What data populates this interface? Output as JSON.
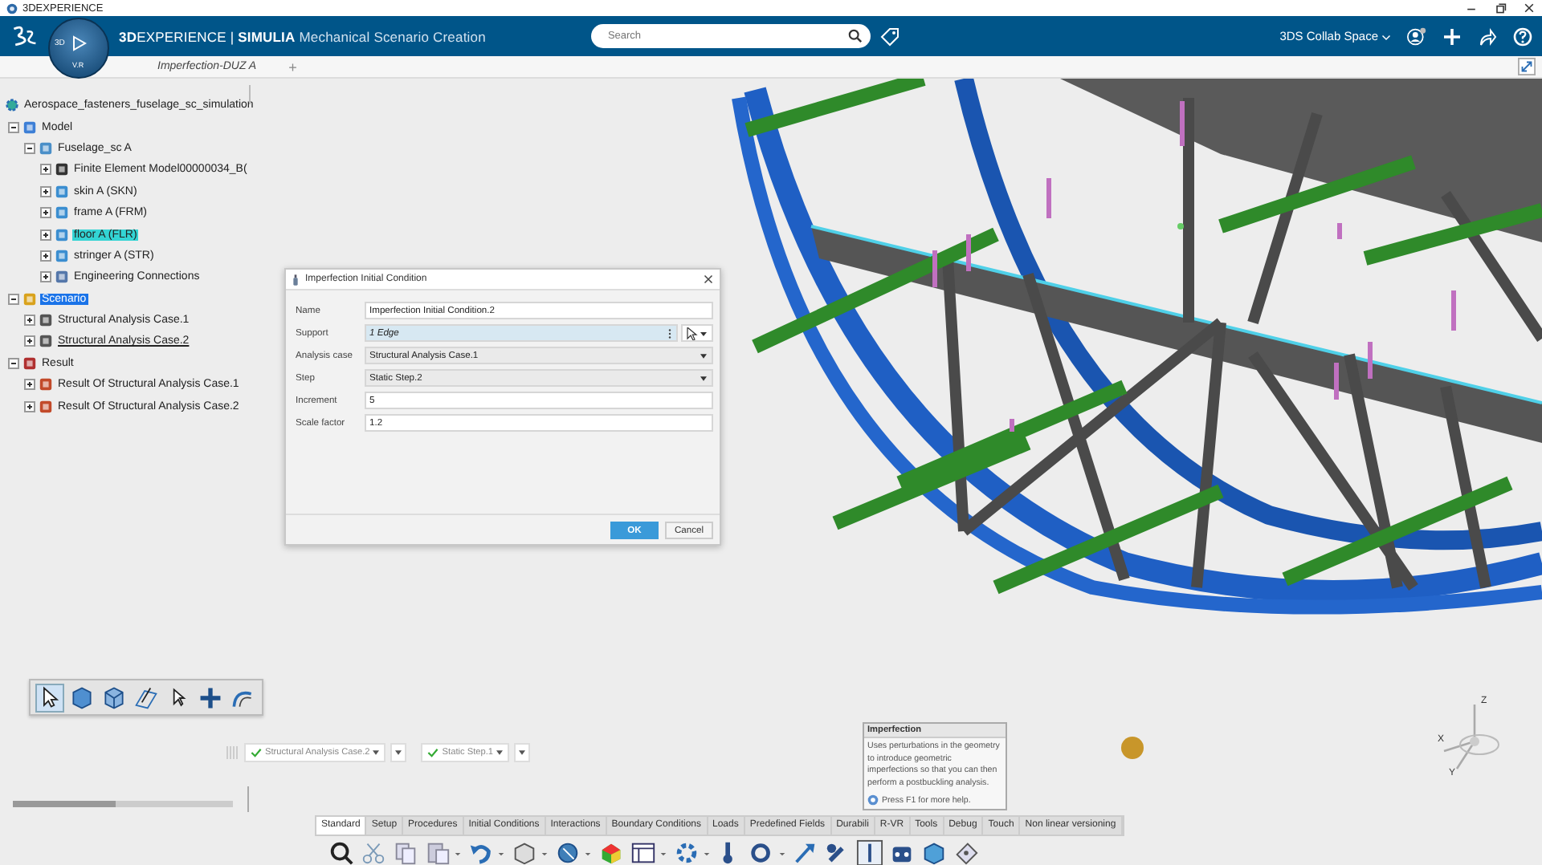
{
  "window": {
    "title": "3DEXPERIENCE"
  },
  "header": {
    "brand_bold": "3D",
    "brand_rest": "EXPERIENCE",
    "separator": "|",
    "app_bold": "SIMULIA",
    "app_name": "Mechanical Scenario Creation",
    "compass_left": "3D",
    "compass_bottom": "V.R",
    "search": {
      "placeholder": "Search"
    },
    "collab_space": "3DS Collab Space"
  },
  "tabs": [
    {
      "label": "Imperfection-DUZ A",
      "selected": true
    }
  ],
  "add_tab": "+",
  "tree": {
    "root": {
      "label": "Aerospace_fasteners_fuselage_sc_simulation",
      "children": [
        {
          "label": "Model",
          "kind": "model",
          "expanded": true,
          "selected": false,
          "highlighted": false,
          "current": false,
          "children": [
            {
              "label": "Fuselage_sc A",
              "kind": "product",
              "expanded": true,
              "selected": false,
              "highlighted": false,
              "current": false,
              "children": [
                {
                  "label": "Finite Element Model00000034_B(",
                  "kind": "mesh",
                  "expanded": false,
                  "selected": false,
                  "highlighted": false,
                  "current": false
                },
                {
                  "label": "skin A (SKN)",
                  "kind": "part",
                  "expanded": false,
                  "selected": false,
                  "highlighted": false,
                  "current": false
                },
                {
                  "label": "frame A (FRM)",
                  "kind": "part",
                  "expanded": false,
                  "selected": false,
                  "highlighted": false,
                  "current": false
                },
                {
                  "label": "floor A (FLR)",
                  "kind": "part",
                  "expanded": false,
                  "selected": false,
                  "highlighted": true,
                  "current": false
                },
                {
                  "label": "stringer A (STR)",
                  "kind": "part",
                  "expanded": false,
                  "selected": false,
                  "highlighted": false,
                  "current": false
                },
                {
                  "label": "Engineering Connections",
                  "kind": "connections",
                  "expanded": false,
                  "selected": false,
                  "highlighted": false,
                  "current": false
                }
              ]
            }
          ]
        },
        {
          "label": "Scenario",
          "kind": "scenario",
          "expanded": true,
          "selected": true,
          "highlighted": false,
          "current": false,
          "children": [
            {
              "label": "Structural Analysis Case.1",
              "kind": "case",
              "expanded": false,
              "selected": false,
              "highlighted": false,
              "current": false
            },
            {
              "label": "Structural Analysis Case.2",
              "kind": "case",
              "expanded": false,
              "selected": false,
              "highlighted": false,
              "current": true
            }
          ]
        },
        {
          "label": "Result",
          "kind": "results",
          "expanded": true,
          "selected": false,
          "highlighted": false,
          "current": false,
          "children": [
            {
              "label": "Result Of Structural Analysis Case.1",
              "kind": "result",
              "expanded": false,
              "selected": false,
              "highlighted": false,
              "current": false
            },
            {
              "label": "Result Of Structural Analysis Case.2",
              "kind": "result",
              "expanded": false,
              "selected": false,
              "highlighted": false,
              "current": false
            }
          ]
        }
      ]
    }
  },
  "dialog": {
    "title": "Imperfection Initial Condition",
    "fields": [
      {
        "label": "Name",
        "kind": "text",
        "value": "Imperfection Initial Condition.2"
      },
      {
        "label": "Support",
        "kind": "selection",
        "value": "1 Edge"
      },
      {
        "label": "Analysis case",
        "kind": "combo",
        "value": "Structural Analysis Case.1"
      },
      {
        "label": "Step",
        "kind": "combo",
        "value": "Static Step.2"
      },
      {
        "label": "Increment",
        "kind": "text",
        "value": "5"
      },
      {
        "label": "Scale factor",
        "kind": "text",
        "value": "1.2"
      }
    ],
    "buttons": [
      {
        "label": "OK",
        "kind": "primary"
      },
      {
        "label": "Cancel",
        "kind": "secondary"
      }
    ]
  },
  "context_bar": [
    {
      "label": "Structural Analysis Case.2",
      "valid": true
    },
    {
      "label": "Static Step.1",
      "valid": true
    }
  ],
  "tooltip": {
    "title": "Imperfection",
    "body": "Uses perturbations in the geometry to introduce geometric imperfections so that you can then perform a postbuckling analysis.",
    "help": "Press F1 for more help."
  },
  "workbench_tabs": [
    {
      "label": "Standard",
      "selected": true
    },
    {
      "label": "Setup",
      "selected": false
    },
    {
      "label": "Procedures",
      "selected": false
    },
    {
      "label": "Initial Conditions",
      "selected": false
    },
    {
      "label": "Interactions",
      "selected": false
    },
    {
      "label": "Boundary Conditions",
      "selected": false
    },
    {
      "label": "Loads",
      "selected": false
    },
    {
      "label": "Predefined Fields",
      "selected": false
    },
    {
      "label": "Durabili",
      "selected": false
    },
    {
      "label": "R-VR",
      "selected": false
    },
    {
      "label": "Tools",
      "selected": false
    },
    {
      "label": "Debug",
      "selected": false
    },
    {
      "label": "Touch",
      "selected": false
    },
    {
      "label": "Non linear versioning",
      "selected": false
    }
  ],
  "axes": {
    "z": "Z",
    "x": "X",
    "y": "Y"
  }
}
